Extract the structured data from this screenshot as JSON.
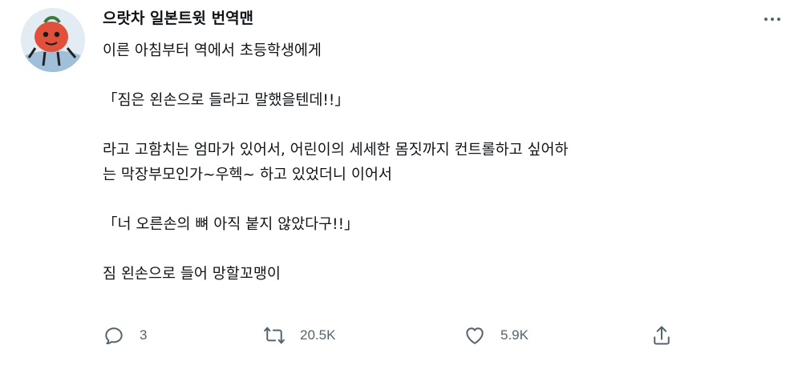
{
  "author": {
    "display_name": "으랏차 일본트윗 번역맨"
  },
  "tweet": {
    "lines": [
      "이른 아침부터 역에서 초등학생에게",
      "",
      "「짐은 왼손으로 들라고 말했을텐데!!」",
      "",
      "라고 고함치는 엄마가 있어서, 어린이의 세세한 몸짓까지 컨트롤하고 싶어하",
      "는 막장부모인가~우헥~ 하고 있었더니 이어서",
      "",
      "「너 오른손의 뼈 아직 붙지 않았다구!!」",
      "",
      "짐 왼손으로 들어 망할꼬맹이"
    ]
  },
  "actions": {
    "reply_count": "3",
    "retweet_count": "20.5K",
    "like_count": "5.9K"
  },
  "icons": {
    "more": "more-icon",
    "reply": "reply-icon",
    "retweet": "retweet-icon",
    "like": "heart-icon",
    "share": "share-icon"
  },
  "colors": {
    "text": "#0f1419",
    "muted": "#536471"
  }
}
